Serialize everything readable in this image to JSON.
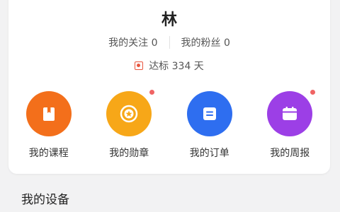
{
  "profile": {
    "name": "林",
    "following": "我的关注 0",
    "followers": "我的粉丝 0",
    "streak": "达标 334 天"
  },
  "shortcuts": [
    {
      "label": "我的课程",
      "icon": "book-icon",
      "color": "#f36f1b",
      "has_dot": false
    },
    {
      "label": "我的勋章",
      "icon": "medal-icon",
      "color": "#f7a718",
      "has_dot": true
    },
    {
      "label": "我的订单",
      "icon": "order-icon",
      "color": "#2e6ef0",
      "has_dot": false
    },
    {
      "label": "我的周报",
      "icon": "report-icon",
      "color": "#9c3fe6",
      "has_dot": true
    }
  ],
  "devices": {
    "title": "我的设备"
  },
  "colors": {
    "background": "#f2f2f3",
    "card": "#ffffff",
    "accent_red": "#e8553e",
    "notification_dot": "#f06464"
  }
}
